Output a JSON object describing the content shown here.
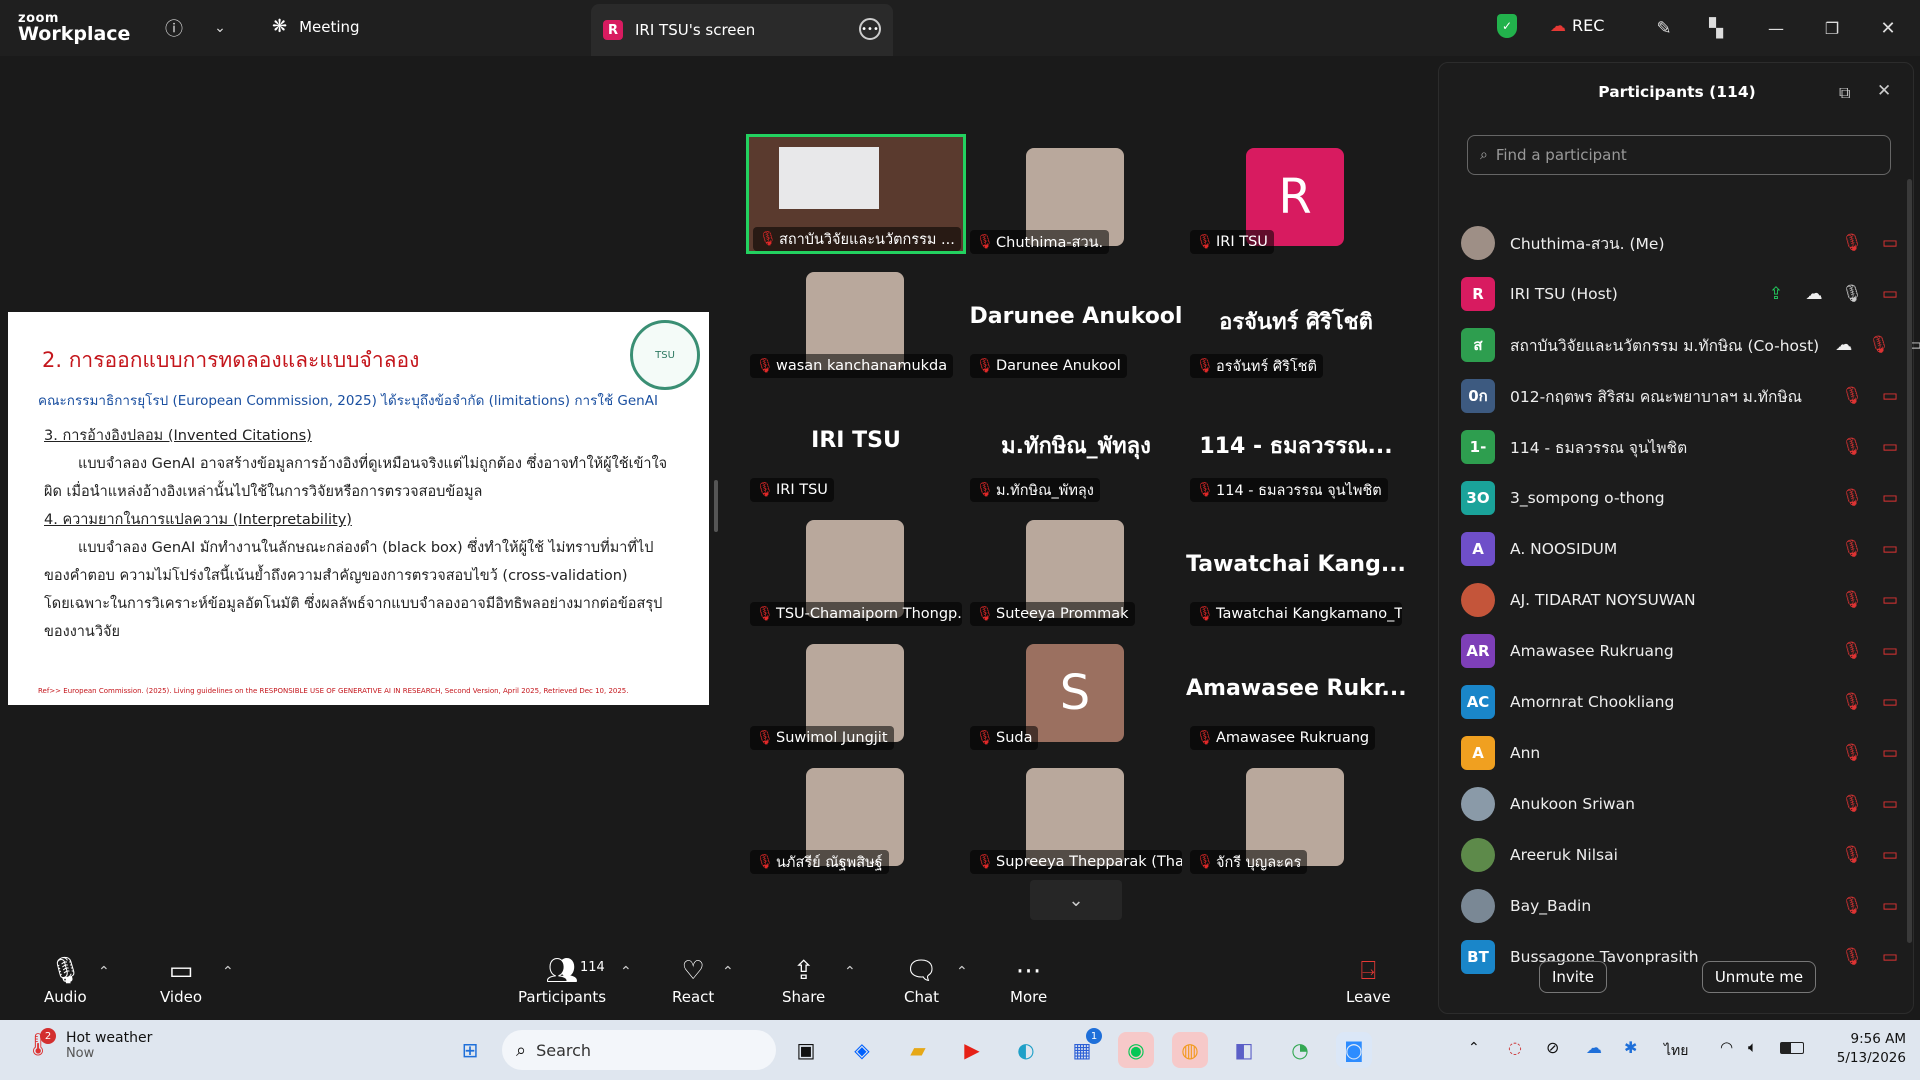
{
  "titlebar": {
    "logo_line1": "zoom",
    "logo_line2": "Workplace",
    "meeting_label": "Meeting",
    "tab_badge": "R",
    "tab_label": "IRI TSU's screen",
    "rec_label": "REC"
  },
  "slide": {
    "heading": "2. การออกแบบการทดลองและแบบจำลอง",
    "subtitle": "คณะกรรมาธิการยุโรป (European Commission, 2025) ได้ระบุถึงข้อจำกัด (limitations) การใช้ GenAI",
    "point3_title": "3. การอ้างอิงปลอม (Invented Citations)",
    "point3_line1": "แบบจำลอง GenAI อาจสร้างข้อมูลการอ้างอิงที่ดูเหมือนจริงแต่ไม่ถูกต้อง ซึ่งอาจทำให้ผู้ใช้เข้าใจ",
    "point3_line2": "ผิด เมื่อนำแหล่งอ้างอิงเหล่านั้นไปใช้ในการวิจัยหรือการตรวจสอบข้อมูล",
    "point4_title": "4. ความยากในการแปลความ (Interpretability)",
    "point4_line1": "แบบจำลอง GenAI มักทำงานในลักษณะกล่องดำ (black box) ซึ่งทำให้ผู้ใช้ ไม่ทราบที่มาที่ไป",
    "point4_line2": "ของคำตอบ ความไม่โปร่งใสนี้เน้นย้ำถึงความสำคัญของการตรวจสอบไขว้ (cross-validation)",
    "point4_line3": "โดยเฉพาะในการวิเคราะห์ข้อมูลอัตโนมัติ ซึ่งผลลัพธ์จากแบบจำลองอาจมีอิทธิพลอย่างมากต่อข้อสรุป",
    "point4_line4": "ของงานวิจัย",
    "reference": "Ref>> European Commission. (2025). Living guidelines on the RESPONSIBLE USE OF GENERATIVE AI IN RESEARCH, Second Version, April 2025, Retrieved Dec 10, 2025."
  },
  "gallery": [
    {
      "name": "สถาบันวิจัยและนวัตกรรม ...",
      "kind": "video",
      "big": ""
    },
    {
      "name": "Chuthima-สวน.",
      "kind": "photo",
      "big": ""
    },
    {
      "name": "IRI TSU",
      "kind": "letter",
      "big": "R"
    },
    {
      "name": "wasan kanchanamukda",
      "kind": "photo",
      "big": ""
    },
    {
      "name": "Darunee Anukool",
      "kind": "text",
      "big": "Darunee Anukool"
    },
    {
      "name": "อรจันทร์ ศิริโชติ",
      "kind": "text",
      "big": "อรจันทร์ ศิริโชติ"
    },
    {
      "name": "IRI TSU",
      "kind": "text",
      "big": "IRI TSU"
    },
    {
      "name": "ม.ทักษิณ_พัทลุง",
      "kind": "text",
      "big": "ม.ทักษิณ_พัทลุง"
    },
    {
      "name": "114 - ธมลวรรณ จุนไพชิต",
      "kind": "text",
      "big": "114 - ธมลวรรณ..."
    },
    {
      "name": "TSU-Chamaiporn Thongp...",
      "kind": "photo",
      "big": ""
    },
    {
      "name": "Suteeya Prommak",
      "kind": "photo",
      "big": ""
    },
    {
      "name": "Tawatchai Kangkamano_T...",
      "kind": "text",
      "big": "Tawatchai Kang..."
    },
    {
      "name": "Suwimol Jungjit",
      "kind": "photo",
      "big": ""
    },
    {
      "name": "Suda",
      "kind": "letter",
      "big": "S"
    },
    {
      "name": "Amawasee Rukruang",
      "kind": "text",
      "big": "Amawasee Rukr..."
    },
    {
      "name": "นภัสรีย์ ณัฐพสิษฐ์",
      "kind": "photo",
      "big": ""
    },
    {
      "name": "Supreeya Thepparak (Tha...",
      "kind": "photo",
      "big": ""
    },
    {
      "name": "จักรี บุญละคร",
      "kind": "photo",
      "big": ""
    }
  ],
  "panel": {
    "title": "Participants (114)",
    "search_placeholder": "Find a participant",
    "invite_label": "Invite",
    "unmute_label": "Unmute me",
    "participants": [
      {
        "name": "Chuthima-สวน. (Me)",
        "avatar": "",
        "color": "#9e8f86"
      },
      {
        "name": "IRI TSU (Host)",
        "avatar": "R",
        "color": "#d81b60"
      },
      {
        "name": "สถาบันวิจัยและนวัตกรรม ม.ทักษิณ (Co-host)",
        "avatar": "ส",
        "color": "#2e9e4f"
      },
      {
        "name": "012-กฤตพร สิริสม คณะพยาบาลฯ ม.ทักษิณ",
        "avatar": "0ก",
        "color": "#3d5a80"
      },
      {
        "name": "114 - ธมลวรรณ จุนไพชิต",
        "avatar": "1-",
        "color": "#2e9e4f"
      },
      {
        "name": "3_sompong o-thong",
        "avatar": "3O",
        "color": "#1aa39a"
      },
      {
        "name": "A. NOOSIDUM",
        "avatar": "A",
        "color": "#6f4fc9"
      },
      {
        "name": "AJ. TIDARAT NOYSUWAN",
        "avatar": "",
        "color": "#c4553a"
      },
      {
        "name": "Amawasee Rukruang",
        "avatar": "AR",
        "color": "#7e3fb8"
      },
      {
        "name": "Amornrat Chookliang",
        "avatar": "AC",
        "color": "#1a86c9"
      },
      {
        "name": "Ann",
        "avatar": "A",
        "color": "#f0a020"
      },
      {
        "name": "Anukoon Sriwan",
        "avatar": "",
        "color": "#8a9aa8"
      },
      {
        "name": "Areeruk Nilsai",
        "avatar": "",
        "color": "#5d8a4a"
      },
      {
        "name": "Bay_Badin",
        "avatar": "",
        "color": "#7a8895"
      },
      {
        "name": "Bussagone Tavonprasith",
        "avatar": "BT",
        "color": "#1a86c9"
      }
    ]
  },
  "toolbar": {
    "audio": "Audio",
    "video": "Video",
    "participants": "Participants",
    "participants_count": "114",
    "react": "React",
    "share": "Share",
    "chat": "Chat",
    "more": "More",
    "leave": "Leave"
  },
  "taskbar": {
    "weather_title": "Hot weather",
    "weather_sub": "Now",
    "weather_badge": "2",
    "search": "Search",
    "lang": "ไทย",
    "time": "9:56 AM",
    "date": "5/13/2026",
    "store_badge": "1"
  }
}
